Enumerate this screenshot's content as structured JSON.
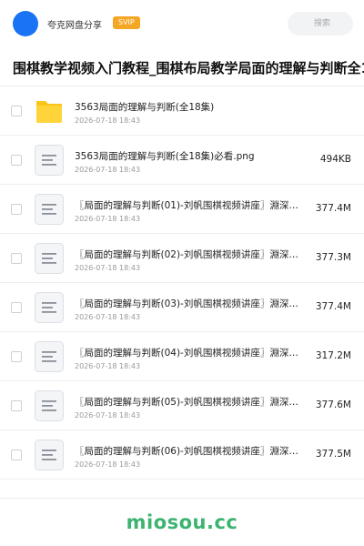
{
  "header": {
    "app_name": "夸克网盘分享",
    "badge": "SVIP",
    "search_placeholder": "搜索"
  },
  "title": "围棋教学视频入门教程_围棋布局教学局面的理解与判断全1",
  "files": [
    {
      "type": "folder",
      "name": "3563局面的理解与判断(全18集)",
      "date": "2026-07-18 18:43",
      "size": ""
    },
    {
      "type": "file",
      "name": "3563局面的理解与判断(全18集)必看.png",
      "date": "2026-07-18 18:43",
      "size": "494KB"
    },
    {
      "type": "file",
      "name": "〖局面的理解与判断(01)-刘帆围棋视频讲座〗淵深…",
      "date": "2026-07-18 18:43",
      "size": "377.4M"
    },
    {
      "type": "file",
      "name": "〖局面的理解与判断(02)-刘帆围棋视频讲座〗淵深…",
      "date": "2026-07-18 18:43",
      "size": "377.3M"
    },
    {
      "type": "file",
      "name": "〖局面的理解与判断(03)-刘帆围棋视频讲座〗淵深…",
      "date": "2026-07-18 18:43",
      "size": "377.4M"
    },
    {
      "type": "file",
      "name": "〖局面的理解与判断(04)-刘帆围棋视频讲座〗淵深…",
      "date": "2026-07-18 18:43",
      "size": "317.2M"
    },
    {
      "type": "file",
      "name": "〖局面的理解与判断(05)-刘帆围棋视频讲座〗淵深…",
      "date": "2026-07-18 18:43",
      "size": "377.6M"
    },
    {
      "type": "file",
      "name": "〖局面的理解与判断(06)-刘帆围棋视频讲座〗淵深…",
      "date": "2026-07-18 18:43",
      "size": "377.5M"
    }
  ],
  "watermark": "miosou.cc",
  "colors": {
    "avatar": "#1a73f5",
    "badge": "#f5a623",
    "folder": "#fcc419",
    "watermark": "#3cb371"
  },
  "icons": {
    "folder": "folder-icon",
    "file": "document-icon"
  }
}
